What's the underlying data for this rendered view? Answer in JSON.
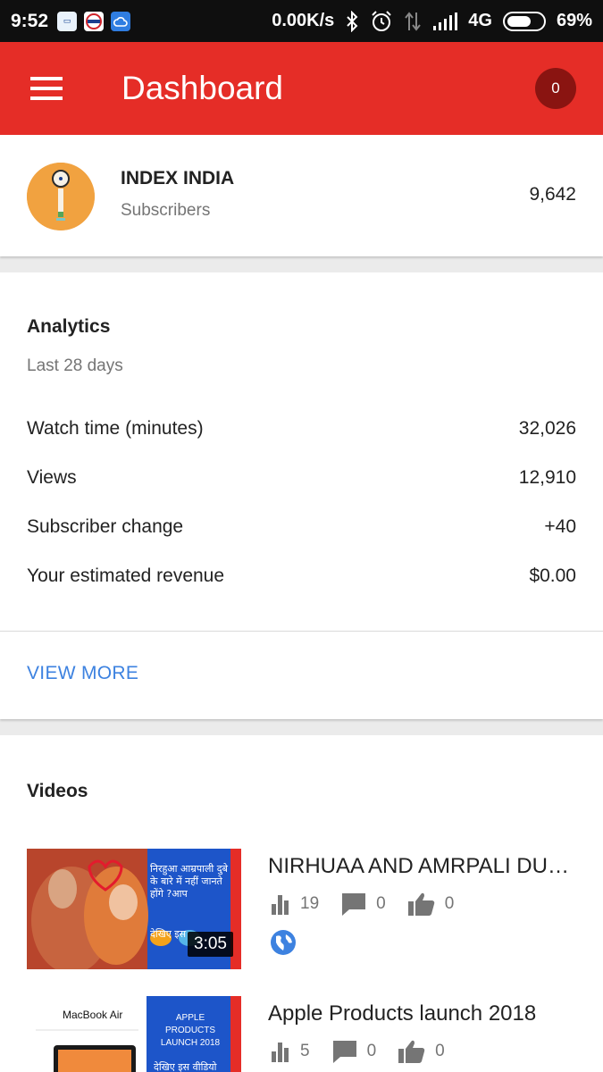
{
  "status_bar": {
    "time": "9:52",
    "network_speed": "0.00K/s",
    "network_type": "4G",
    "battery": "69%",
    "battery_level": 0.69,
    "app_icons": [
      "paytm-icon",
      "ixigo-icon",
      "cloud-icon"
    ]
  },
  "app_bar": {
    "title": "Dashboard",
    "notification_count": "0",
    "color": "#e52d27"
  },
  "channel": {
    "name": "INDEX INDIA",
    "subtitle": "Subscribers",
    "subscriber_count": "9,642"
  },
  "analytics": {
    "title": "Analytics",
    "period": "Last 28 days",
    "metrics": [
      {
        "label": "Watch time (minutes)",
        "value": "32,026"
      },
      {
        "label": "Views",
        "value": "12,910"
      },
      {
        "label": "Subscriber change",
        "value": "+40"
      },
      {
        "label": "Your estimated revenue",
        "value": "$0.00"
      }
    ],
    "view_more": "VIEW MORE",
    "link_color": "#3d82e0"
  },
  "videos": {
    "title": "Videos",
    "items": [
      {
        "title": "NIRHUAA AND AMRPALI DUBEY",
        "views": "19",
        "comments": "0",
        "likes": "0",
        "duration": "3:05",
        "visibility_icon": "globe-icon",
        "thumb_text": "निरहुआ आम्रपाली दुबे के बारे में नहीं जानते होंगे ?आप",
        "thumb_text2": "देखिए इस"
      },
      {
        "title": "Apple Products launch 2018",
        "views": "5",
        "comments": "0",
        "likes": "0",
        "thumb_product": "MacBook Air",
        "thumb_text": "APPLE PRODUCTS LAUNCH 2018",
        "thumb_text2": "देखिए इस वीडियो"
      }
    ]
  }
}
